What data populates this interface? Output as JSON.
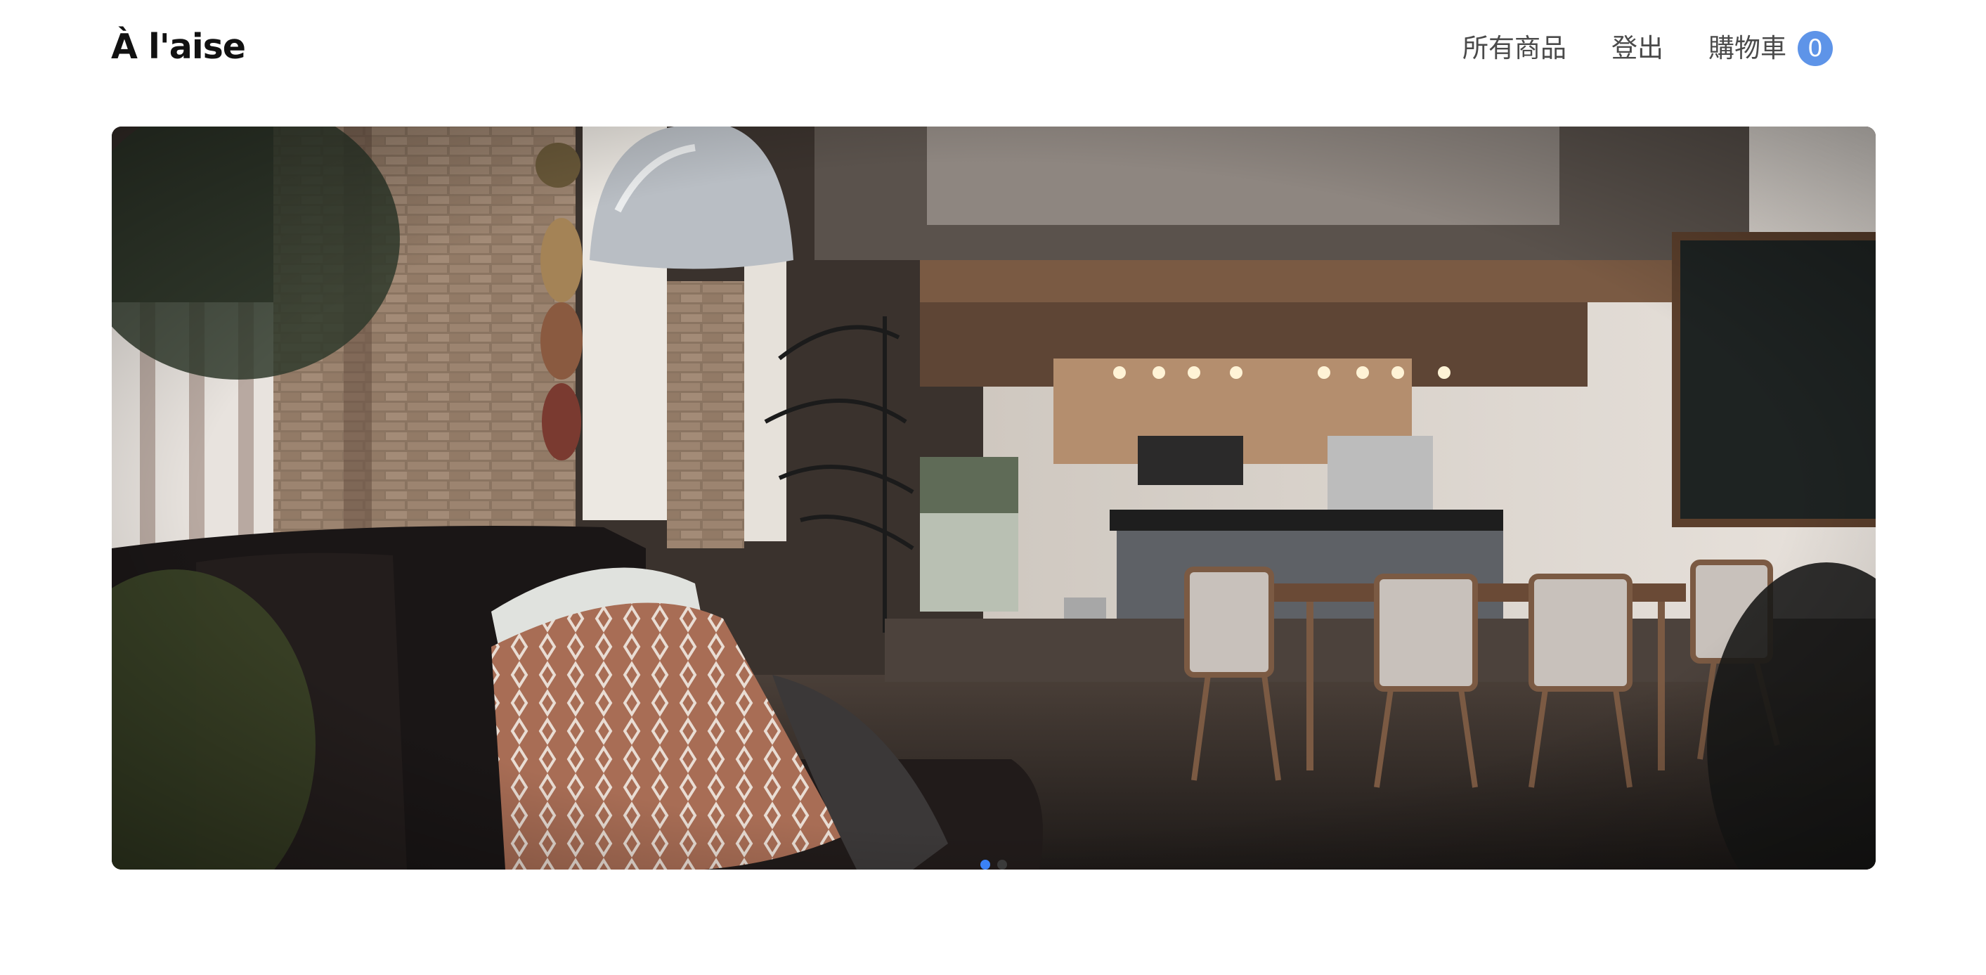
{
  "brand": {
    "name": "À l'aise"
  },
  "nav": {
    "all_products": "所有商品",
    "logout": "登出",
    "cart_label": "購物車",
    "cart_count": "0"
  },
  "hero": {
    "image_description_icon": "loft-living-room-image",
    "active_slide": 1,
    "slide_count": 2
  },
  "colors": {
    "accent": "#3b82f6",
    "badge": "#5e94e8",
    "text_dark": "#111111",
    "nav_text": "#4a4a4a"
  }
}
